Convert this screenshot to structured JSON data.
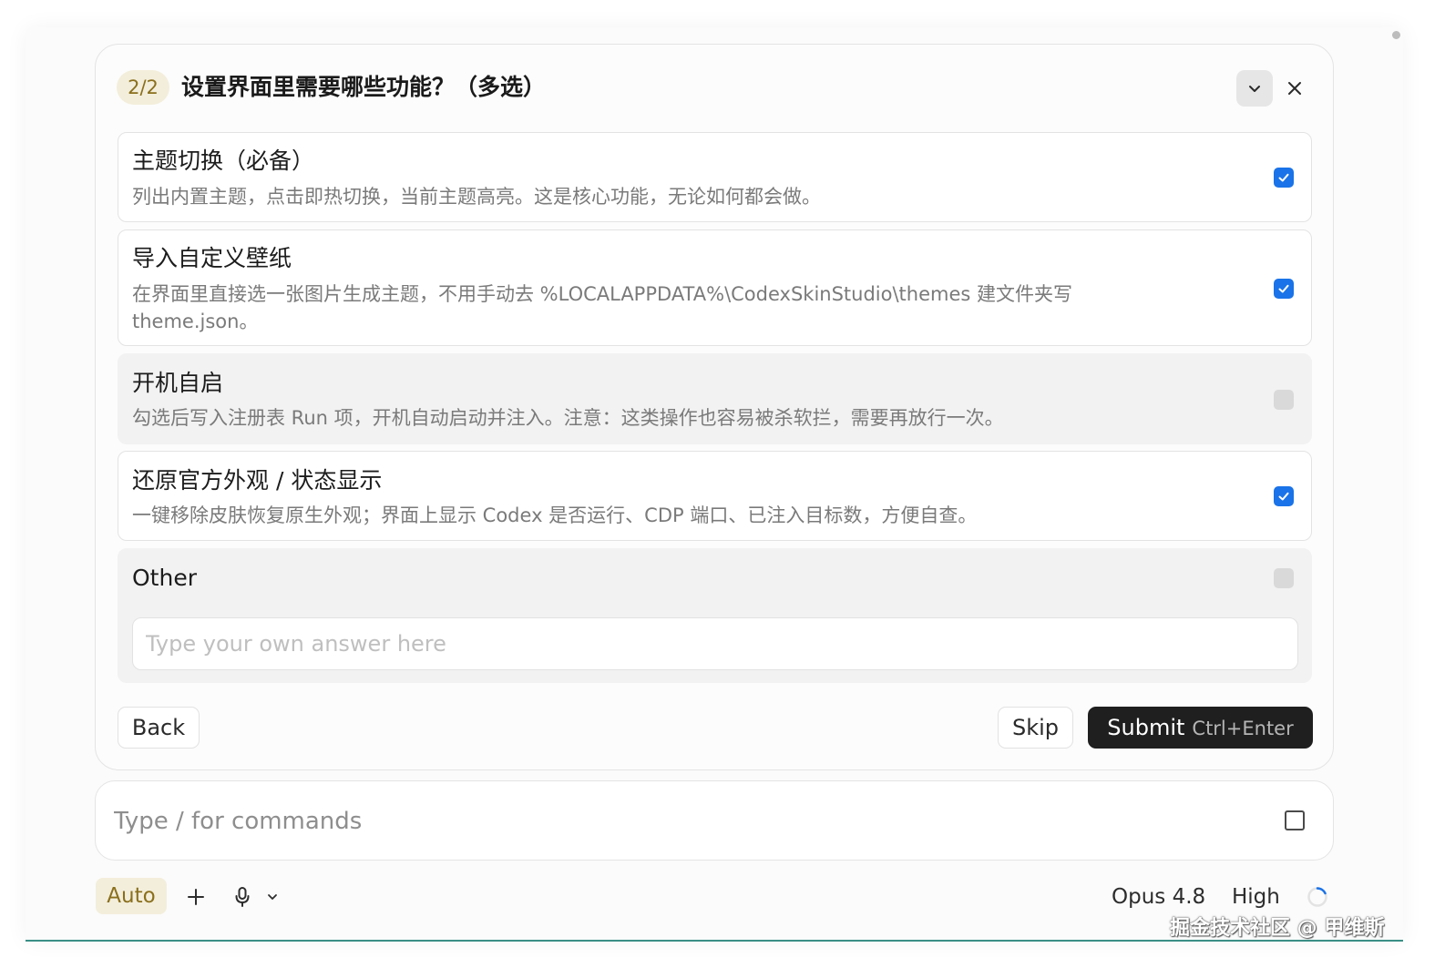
{
  "question": {
    "step": "2/2",
    "title": "设置界面里需要哪些功能？（多选）"
  },
  "header_icons": {
    "collapse": "chevron-down-icon",
    "close": "close-icon"
  },
  "options": [
    {
      "title": "主题切换（必备）",
      "description": "列出内置主题，点击即热切换，当前主题高亮。这是核心功能，无论如何都会做。",
      "checked": true
    },
    {
      "title": "导入自定义壁纸",
      "description": "在界面里直接选一张图片生成主题，不用手动去 %LOCALAPPDATA%\\CodexSkinStudio\\themes 建文件夹写 theme.json。",
      "checked": true
    },
    {
      "title": "开机自启",
      "description": "勾选后写入注册表 Run 项，开机自动启动并注入。注意：这类操作也容易被杀软拦，需要再放行一次。",
      "checked": false
    },
    {
      "title": "还原官方外观 / 状态显示",
      "description": "一键移除皮肤恢复原生外观；界面上显示 Codex 是否运行、CDP 端口、已注入目标数，方便自查。",
      "checked": true
    }
  ],
  "other": {
    "label": "Other",
    "checked": false,
    "placeholder": "Type your own answer here",
    "value": ""
  },
  "actions": {
    "back_label": "Back",
    "skip_label": "Skip",
    "submit_label": "Submit",
    "submit_hint": "Ctrl+Enter"
  },
  "composer": {
    "placeholder": "Type / for commands",
    "expand_icon": "expand-icon"
  },
  "footer": {
    "mode": "Auto",
    "add_icon": "plus-icon",
    "mic_icon": "microphone-icon",
    "mic_menu_icon": "chevron-down-icon",
    "model": "Opus 4.8",
    "effort": "High",
    "status_icon": "spinner-icon"
  },
  "watermark": "掘金技术社区 @ 甲维斯",
  "colors": {
    "accent_badge_bg": "#f3eedb",
    "accent_badge_text": "#8a6f1c",
    "checkbox_checked": "#1a73e8",
    "submit_bg": "#1f1f1f",
    "frame_bottom_border": "#3a8f86"
  }
}
